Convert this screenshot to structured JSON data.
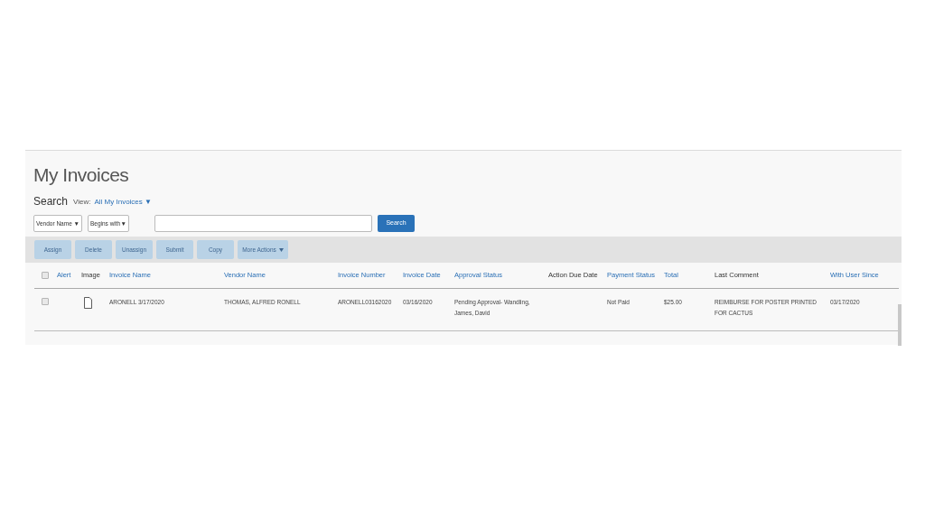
{
  "title": "My Invoices",
  "search": {
    "label": "Search",
    "view_label": "View:",
    "view_value": "All My Invoices",
    "arrow": "▼",
    "field_select": "Vendor Name",
    "operator_select": "Begins with",
    "select_arrow": "▼",
    "button": "Search"
  },
  "actions": [
    {
      "label": "Assign",
      "disabled": true
    },
    {
      "label": "Delete",
      "disabled": true
    },
    {
      "label": "Unassign",
      "disabled": true
    },
    {
      "label": "Submit",
      "disabled": true
    },
    {
      "label": "Copy",
      "disabled": true
    },
    {
      "label": "More Actions",
      "disabled": true,
      "kind": "menu"
    }
  ],
  "table": {
    "select_all": {
      "checked": false
    },
    "columns": [
      {
        "label": "Alert",
        "sortable": true
      },
      {
        "label": "Image",
        "sortable": false
      },
      {
        "label": "Invoice Name",
        "sortable": true
      },
      {
        "label": "Vendor Name",
        "sortable": true
      },
      {
        "label": "Invoice Number",
        "sortable": true
      },
      {
        "label": "Invoice Date",
        "sortable": true
      },
      {
        "label": "Approval Status",
        "sortable": true
      },
      {
        "label": "Action Due Date",
        "sortable": false
      },
      {
        "label": "Payment Status",
        "sortable": true
      },
      {
        "label": "Total",
        "sortable": true
      },
      {
        "label": "Last Comment",
        "sortable": false
      },
      {
        "label": "With User Since",
        "sortable": true
      }
    ],
    "rows": [
      {
        "checked": false,
        "has_image": true,
        "cells": [
          "",
          "",
          "ARONELL 3/17/2020",
          "THOMAS, ALFRED RONELL",
          "ARONELL03162020",
          "03/16/2020",
          "Pending Approval- Wandling, James, David",
          "",
          "Not Paid",
          "$25.00",
          "REIMBURSE FOR POSTER PRINTED FOR CACTUS",
          "03/17/2020"
        ]
      }
    ]
  }
}
